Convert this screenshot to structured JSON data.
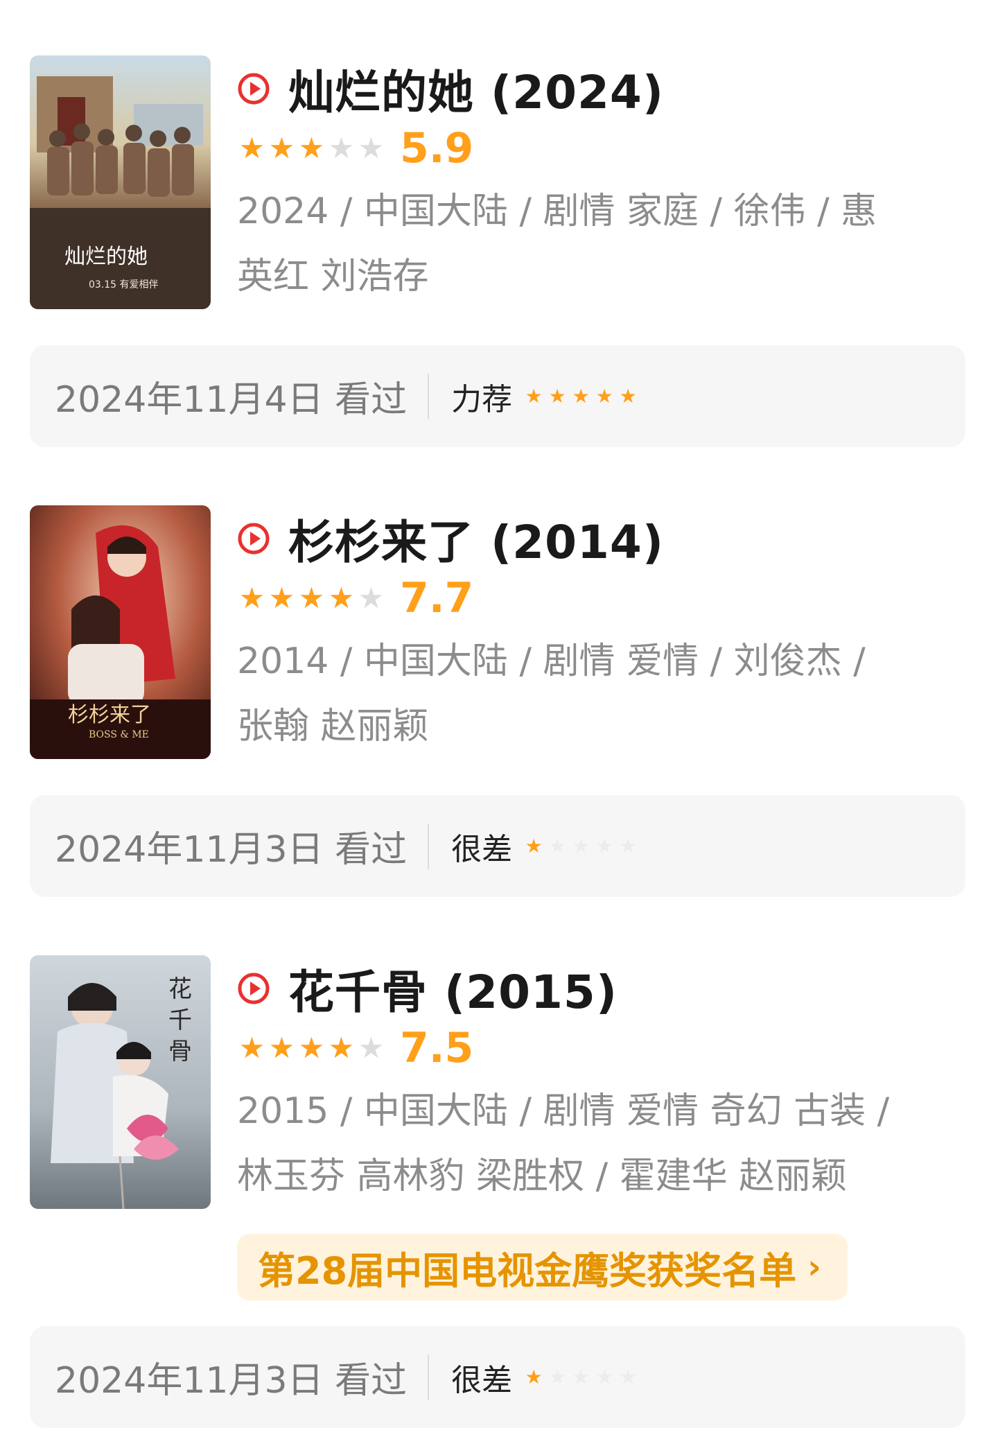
{
  "colors": {
    "accent": "#ff9f1a",
    "play": "#e8312f",
    "award_bg": "#fff3de",
    "award_text": "#e59400"
  },
  "entries": [
    {
      "title": "灿烂的她 (2024)",
      "stars_filled": 3,
      "stars_total": 5,
      "score": "5.9",
      "meta_line1": "2024 / 中国大陆 / 剧情 家庭 / 徐伟 / 惠",
      "meta_line2": "英红 刘浩存",
      "poster_icon": "movie-poster",
      "log": {
        "date": "2024年11月4日 看过",
        "verdict": "力荐",
        "stars_filled": 5
      }
    },
    {
      "title": "杉杉来了 (2014)",
      "stars_filled": 4,
      "stars_total": 5,
      "score": "7.7",
      "meta_line1": "2014 / 中国大陆 / 剧情 爱情 / 刘俊杰 /",
      "meta_line2": "张翰 赵丽颖",
      "poster_icon": "movie-poster",
      "log": {
        "date": "2024年11月3日 看过",
        "verdict": "很差",
        "stars_filled": 1
      }
    },
    {
      "title": "花千骨 (2015)",
      "stars_filled": 4,
      "stars_total": 5,
      "score": "7.5",
      "meta_line1": "2015 / 中国大陆 / 剧情 爱情 奇幻 古装 /",
      "meta_line2": "林玉芬 高林豹 梁胜权 / 霍建华 赵丽颖",
      "award": "第28届中国电视金鹰奖获奖名单",
      "poster_icon": "movie-poster",
      "log": {
        "date": "2024年11月3日 看过",
        "verdict": "很差",
        "stars_filled": 1
      }
    }
  ]
}
